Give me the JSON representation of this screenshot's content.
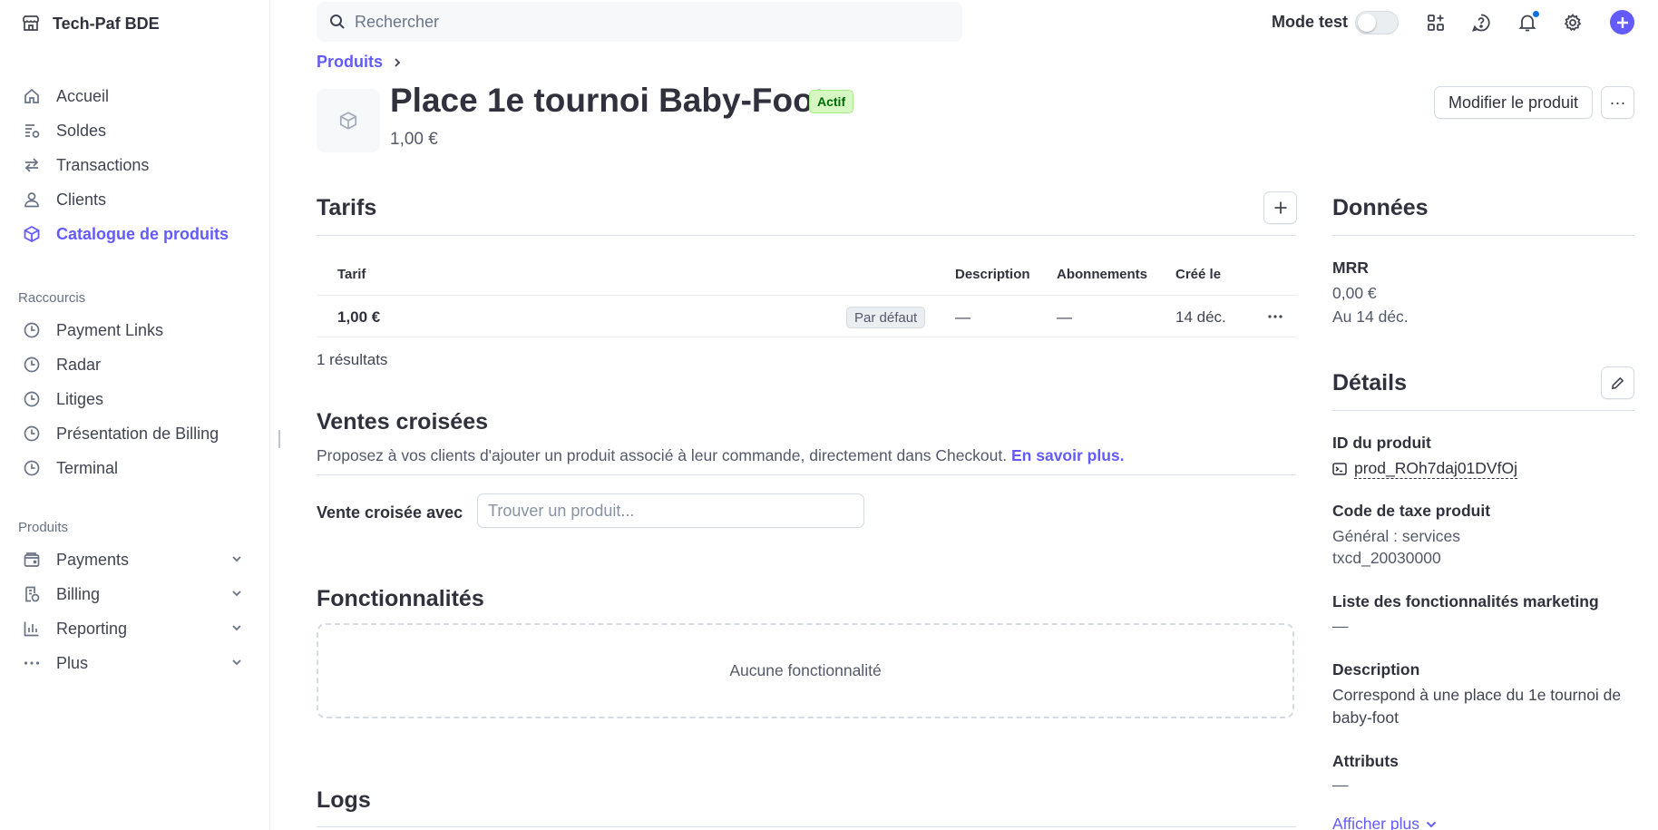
{
  "sidebar": {
    "org_name": "Tech-Paf BDE",
    "main_items": [
      {
        "label": "Accueil",
        "icon": "home-icon"
      },
      {
        "label": "Soldes",
        "icon": "balance-icon"
      },
      {
        "label": "Transactions",
        "icon": "arrows-icon"
      },
      {
        "label": "Clients",
        "icon": "person-icon"
      },
      {
        "label": "Catalogue de produits",
        "icon": "box-icon",
        "active": true
      }
    ],
    "shortcuts_label": "Raccourcis",
    "shortcuts": [
      {
        "label": "Payment Links",
        "icon": "clock-icon"
      },
      {
        "label": "Radar",
        "icon": "clock-icon"
      },
      {
        "label": "Litiges",
        "icon": "clock-icon"
      },
      {
        "label": "Présentation de Billing",
        "icon": "clock-icon"
      },
      {
        "label": "Terminal",
        "icon": "clock-icon"
      }
    ],
    "products_label": "Produits",
    "products": [
      {
        "label": "Payments",
        "icon": "wallet-icon"
      },
      {
        "label": "Billing",
        "icon": "receipt-icon"
      },
      {
        "label": "Reporting",
        "icon": "chart-icon"
      },
      {
        "label": "Plus",
        "icon": "dots-icon"
      }
    ]
  },
  "topbar": {
    "search_placeholder": "Rechercher",
    "mode_test_label": "Mode test",
    "mode_test_on": false
  },
  "header": {
    "breadcrumb": "Produits",
    "title": "Place 1e tournoi Baby-Foot",
    "status": "Actif",
    "price": "1,00 €",
    "edit_button": "Modifier le produit",
    "more_button": "···"
  },
  "tarifs": {
    "title": "Tarifs",
    "columns": [
      "Tarif",
      "Description",
      "Abonnements",
      "Créé le"
    ],
    "rows": [
      {
        "tarif": "1,00 €",
        "badge": "Par défaut",
        "description": "—",
        "abonnements": "—",
        "cree_le": "14 déc."
      }
    ],
    "results": "1 résultats"
  },
  "cross_sell": {
    "title": "Ventes croisées",
    "description": "Proposez à vos clients d'ajouter un produit associé à leur commande, directement dans Checkout.",
    "link": "En savoir plus.",
    "field_label": "Vente croisée avec",
    "field_placeholder": "Trouver un produit..."
  },
  "features": {
    "title": "Fonctionnalités",
    "empty": "Aucune fonctionnalité"
  },
  "logs": {
    "title": "Logs"
  },
  "donnees": {
    "title": "Données",
    "mrr_label": "MRR",
    "mrr_value": "0,00 €",
    "mrr_date": "Au 14 déc."
  },
  "details": {
    "title": "Détails",
    "product_id_label": "ID du produit",
    "product_id": "prod_ROh7daj01DVfOj",
    "tax_label": "Code de taxe produit",
    "tax_name": "Général : services",
    "tax_code": "txcd_20030000",
    "marketing_label": "Liste des fonctionnalités marketing",
    "marketing_value": "—",
    "description_label": "Description",
    "description_line1": "Correspond à une place du 1e tournoi de",
    "description_line2": "baby-foot",
    "attributes_label": "Attributs",
    "attributes_value": "—",
    "show_more": "Afficher plus"
  },
  "colors": {
    "accent": "#635bff",
    "active_badge_bg": "#d7f7c2",
    "active_badge_text": "#006908",
    "text": "#30313d",
    "muted": "#687385"
  }
}
